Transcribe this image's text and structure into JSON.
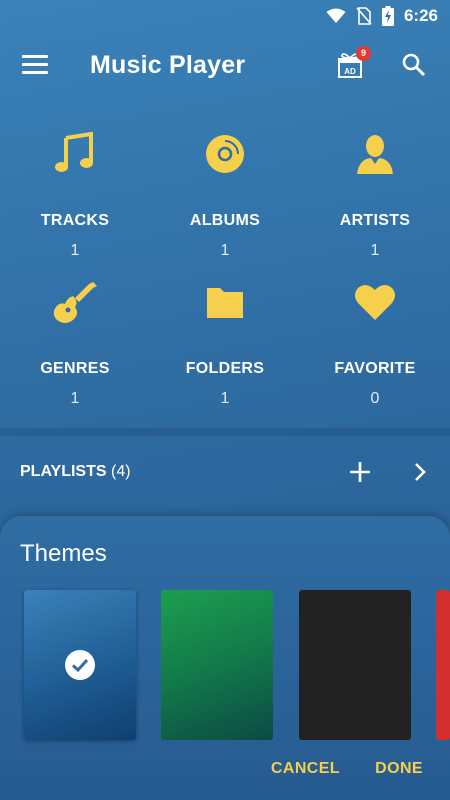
{
  "status_bar": {
    "time": "6:26"
  },
  "app_bar": {
    "title": "Music Player",
    "ad_badge_count": "9",
    "ad_label": "AD"
  },
  "categories": [
    {
      "label": "TRACKS",
      "count": "1",
      "icon": "music-note-icon"
    },
    {
      "label": "ALBUMS",
      "count": "1",
      "icon": "album-disc-icon"
    },
    {
      "label": "ARTISTS",
      "count": "1",
      "icon": "artist-person-icon"
    },
    {
      "label": "GENRES",
      "count": "1",
      "icon": "guitar-icon"
    },
    {
      "label": "FOLDERS",
      "count": "1",
      "icon": "folder-icon"
    },
    {
      "label": "FAVORITE",
      "count": "0",
      "icon": "heart-icon"
    }
  ],
  "playlists": {
    "label": "PLAYLISTS",
    "count": "(4)"
  },
  "themes": {
    "title": "Themes",
    "swatches": [
      {
        "name": "blue",
        "color": "#2f6da3",
        "selected": true
      },
      {
        "name": "green",
        "color": "#1d9e4f",
        "selected": false
      },
      {
        "name": "black",
        "color": "#222222",
        "selected": false
      },
      {
        "name": "red",
        "color": "#d32f2f",
        "selected": false
      }
    ],
    "cancel_label": "CANCEL",
    "done_label": "DONE"
  },
  "colors": {
    "accent": "#f6cf4d",
    "background": "#2f6da3",
    "badge": "#e53935"
  }
}
